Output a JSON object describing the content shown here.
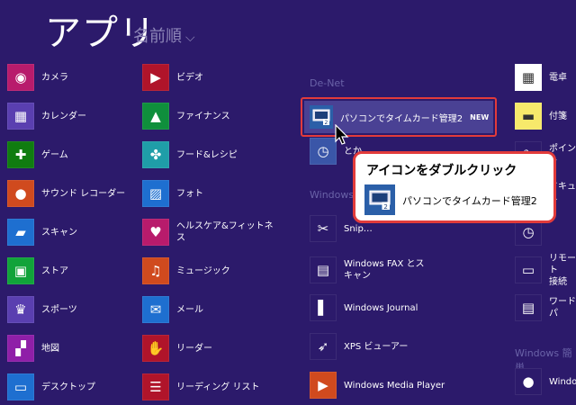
{
  "header": {
    "title": "アプリ",
    "sort_label": "名前順",
    "sort_chevron": "⌵"
  },
  "groups": {
    "denet": "De-Net",
    "windows": "Windows",
    "windows_simple": "Windows 簡単"
  },
  "col1": [
    {
      "label": "カメラ",
      "color": "#b81b6c",
      "icon": "camera-icon",
      "glyph": "◉"
    },
    {
      "label": "カレンダー",
      "color": "#5a3fb0",
      "icon": "calendar-icon",
      "glyph": "▦"
    },
    {
      "label": "ゲーム",
      "color": "#107c10",
      "icon": "gamepad-icon",
      "glyph": "✚"
    },
    {
      "label": "サウンド レコーダー",
      "color": "#d04a1e",
      "icon": "microphone-icon",
      "glyph": "●"
    },
    {
      "label": "スキャン",
      "color": "#1e6fd0",
      "icon": "scanner-icon",
      "glyph": "▰"
    },
    {
      "label": "ストア",
      "color": "#11a33a",
      "icon": "store-icon",
      "glyph": "▣"
    },
    {
      "label": "スポーツ",
      "color": "#5a3fb0",
      "icon": "trophy-icon",
      "glyph": "♛"
    },
    {
      "label": "地図",
      "color": "#8f1fa8",
      "icon": "map-icon",
      "glyph": "▞"
    },
    {
      "label": "デスクトップ",
      "color": "#1e6fd0",
      "icon": "desktop-icon",
      "glyph": "▭"
    }
  ],
  "col2": [
    {
      "label": "ビデオ",
      "color": "#b0142a",
      "icon": "video-icon",
      "glyph": "▶"
    },
    {
      "label": "ファイナンス",
      "color": "#0f8f3c",
      "icon": "finance-chart-icon",
      "glyph": "▲"
    },
    {
      "label": "フード&レシピ",
      "color": "#1f9ea8",
      "icon": "food-icon",
      "glyph": "✤"
    },
    {
      "label": "フォト",
      "color": "#1e6fd0",
      "icon": "photo-icon",
      "glyph": "▨"
    },
    {
      "label": "ヘルスケア&フィットネ\nス",
      "color": "#b81b6c",
      "icon": "health-heart-icon",
      "glyph": "♥"
    },
    {
      "label": "ミュージック",
      "color": "#d04a1e",
      "icon": "headphones-icon",
      "glyph": "♫"
    },
    {
      "label": "メール",
      "color": "#1e6fd0",
      "icon": "mail-icon",
      "glyph": "✉"
    },
    {
      "label": "リーダー",
      "color": "#b0142a",
      "icon": "reader-icon",
      "glyph": "✋"
    },
    {
      "label": "リーディング リスト",
      "color": "#b0142a",
      "icon": "reading-list-icon",
      "glyph": "☰"
    }
  ],
  "col3": [
    {
      "label": "Snip…",
      "color": "#2c1a6b",
      "icon": "snipping-icon",
      "glyph": "✂"
    },
    {
      "label": "Windows FAX とス\nキャン",
      "color": "#2c1a6b",
      "icon": "fax-icon",
      "glyph": "▤"
    },
    {
      "label": "Windows Journal",
      "color": "#2c1a6b",
      "icon": "journal-icon",
      "glyph": "▌"
    },
    {
      "label": "XPS ビューアー",
      "color": "#2c1a6b",
      "icon": "xps-viewer-icon",
      "glyph": "➶"
    },
    {
      "label": "Windows Media Player",
      "color": "#d04a1e",
      "icon": "media-player-icon",
      "glyph": "▶"
    }
  ],
  "col4": [
    {
      "label": "電卓",
      "color": "#ffffff",
      "icon": "calculator-icon",
      "glyph": "▦"
    },
    {
      "label": "付箋",
      "color": "#f7e96b",
      "icon": "sticky-note-icon",
      "glyph": "▬"
    },
    {
      "label": "ポイント",
      "color": "#2c1a6b",
      "icon": "paint-icon",
      "glyph": "✎"
    },
    {
      "label": "ドキュメ",
      "color": "#2c1a6b",
      "icon": "document-icon",
      "glyph": "▥"
    },
    {
      "label": "",
      "color": "#2c1a6b",
      "icon": "clock-icon",
      "glyph": "◷"
    },
    {
      "label": "リモート\n接続",
      "color": "#2c1a6b",
      "icon": "remote-desktop-icon",
      "glyph": "▭"
    },
    {
      "label": "ワードパ",
      "color": "#2c1a6b",
      "icon": "wordpad-icon",
      "glyph": "▤"
    }
  ],
  "highlight": {
    "label": "パソコンでタイムカード管理2",
    "badge": "NEW",
    "second_label": "とか…"
  },
  "callout": {
    "title": "アイコンをダブルクリック",
    "app_name": "パソコンでタイムカード管理2"
  },
  "windows_simple_item": "Windo…",
  "colors": {
    "background": "#2c1a6b",
    "highlight_border": "#e23b3b"
  }
}
